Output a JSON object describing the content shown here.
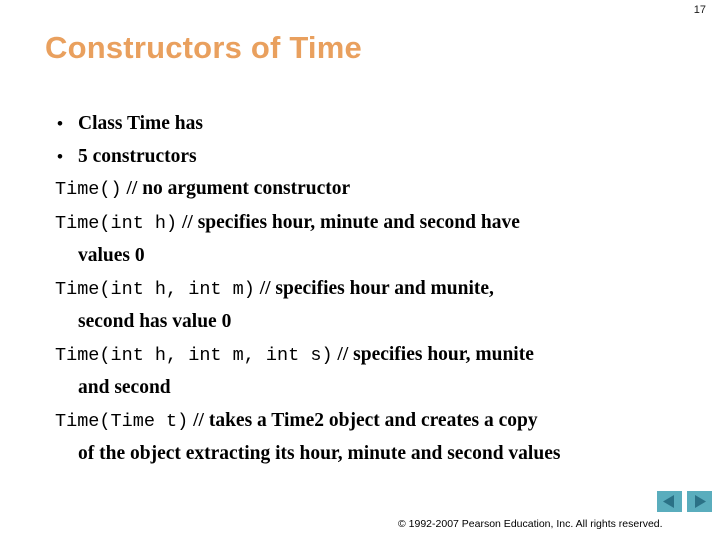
{
  "slide": {
    "page_number": "17",
    "title": "Constructors of Time",
    "title_color": "#e9a05e",
    "background_color": "#ffffff",
    "text_color": "#000000"
  },
  "content": {
    "bullets": [
      {
        "marker": "•",
        "text": "Class Time has"
      },
      {
        "marker": "•",
        "text": "5 constructors"
      }
    ],
    "constructors": [
      {
        "signature": "Time()",
        "comment": "// no argument constructor",
        "continuation": ""
      },
      {
        "signature": "Time(int h)",
        "comment": "// specifies hour, minute and second have",
        "continuation": "values 0"
      },
      {
        "signature": "Time(int h, int m)",
        "comment": "// specifies hour and munite,",
        "continuation": "second has value 0"
      },
      {
        "signature": "Time(int h, int m, int s)",
        "comment": "// specifies  hour, munite",
        "continuation": "and second"
      },
      {
        "signature": "Time(Time t)",
        "comment": "// takes a Time2 object and creates a copy",
        "continuation": "of the object extracting its hour, minute and second values"
      }
    ]
  },
  "footer": {
    "copyright": "© 1992-2007 Pearson Education, Inc.  All rights reserved.",
    "nav": {
      "previous_label": "Previous slide",
      "next_label": "Next slide",
      "button_color": "#5aadbd",
      "arrow_color": "#2b7186"
    }
  }
}
